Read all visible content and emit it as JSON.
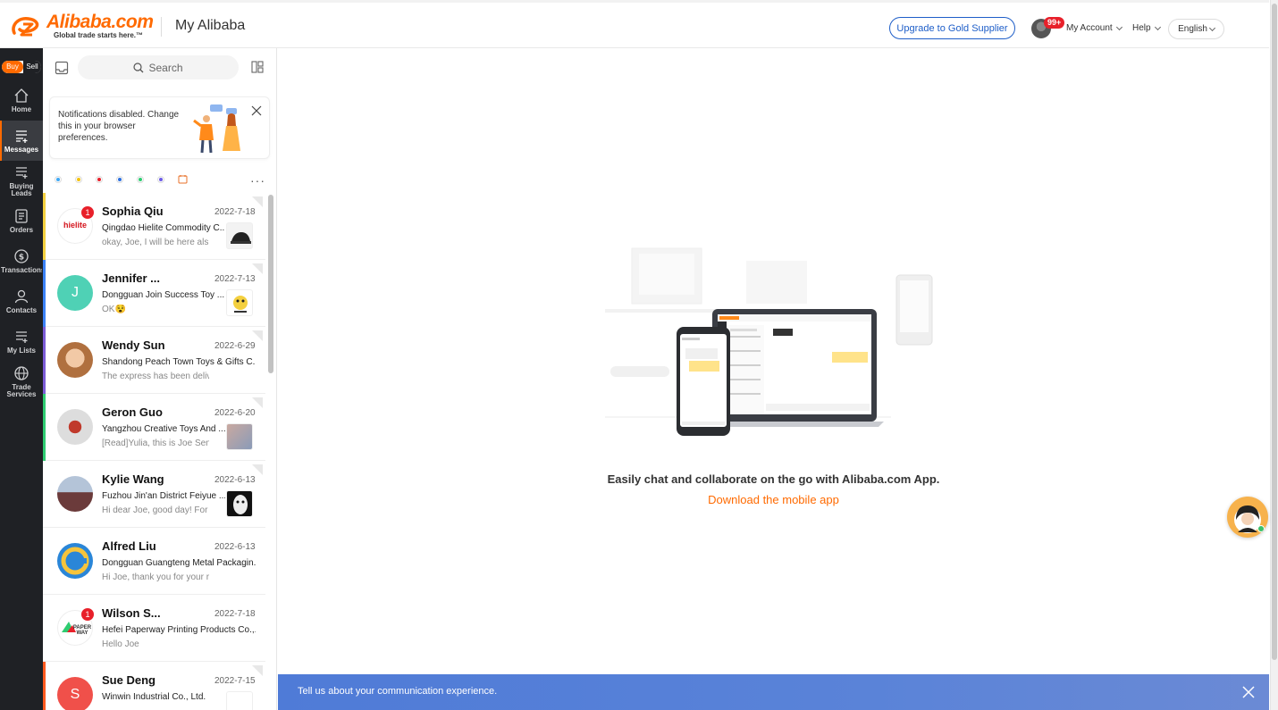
{
  "header": {
    "logo_word": "Alibaba.com",
    "logo_tagline": "Global trade starts here.™",
    "page_title": "My Alibaba",
    "gold_button": "Upgrade to Gold Supplier",
    "account_badge": "99+",
    "account_label": "My Account",
    "help_label": "Help",
    "language_label": "English",
    "brand_color": "#ff6a00"
  },
  "rail": {
    "buy": "Buy",
    "sell": "Sell",
    "items": [
      {
        "label": "Home",
        "icon": "home-icon"
      },
      {
        "label": "Messages",
        "icon": "messages-icon"
      },
      {
        "label": "Buying Leads",
        "icon": "buying-leads-icon"
      },
      {
        "label": "Orders",
        "icon": "orders-icon"
      },
      {
        "label": "Transactions",
        "icon": "dollar-icon"
      },
      {
        "label": "Contacts",
        "icon": "contacts-icon"
      },
      {
        "label": "My Lists",
        "icon": "list-icon"
      },
      {
        "label": "Trade Services",
        "icon": "globe-icon"
      }
    ]
  },
  "panel": {
    "search_placeholder": "Search",
    "notice": "Notifications disabled. Change this in your browser preferences.",
    "more": "···",
    "conversations": [
      {
        "name": "Sophia Qiu",
        "date": "2022-7-18",
        "company": "Qingdao Hielite Commodity C...",
        "preview": "okay, Joe, I will be here als",
        "badge": "1",
        "stripe": "#f4d03f"
      },
      {
        "name": "Jennifer ...",
        "date": "2022-7-13",
        "company": "Dongguan Join Success Toy ...",
        "preview": "OK😵",
        "badge": "",
        "stripe": "#3b82f6",
        "initial": "J"
      },
      {
        "name": "Wendy Sun",
        "date": "2022-6-29",
        "company": "Shandong Peach Town Toys & Gifts C...",
        "preview": "The express has been deliv...",
        "badge": "",
        "stripe": "#7c5cd6"
      },
      {
        "name": "Geron Guo",
        "date": "2022-6-20",
        "company": "Yangzhou Creative Toys And ...",
        "preview": "[Read]Yulia, this is Joe Sena...",
        "badge": "",
        "stripe": "#2ecc71"
      },
      {
        "name": "Kylie Wang",
        "date": "2022-6-13",
        "company": "Fuzhou Jin'an District Feiyue ...",
        "preview": "Hi dear Joe, good day! For",
        "badge": "",
        "stripe": ""
      },
      {
        "name": "Alfred Liu",
        "date": "2022-6-13",
        "company": "Dongguan Guangteng Metal Packagin...",
        "preview": "Hi Joe, thank you for your r...",
        "badge": "",
        "stripe": ""
      },
      {
        "name": "Wilson S...",
        "date": "2022-7-18",
        "company": "Hefei Paperway Printing Products Co.,...",
        "preview": "Hello Joe",
        "badge": "1",
        "stripe": ""
      },
      {
        "name": "Sue Deng",
        "date": "2022-7-15",
        "company": "Winwin Industrial Co., Ltd.",
        "preview": "",
        "badge": "",
        "stripe": "#ff5a1f",
        "initial": "S"
      }
    ]
  },
  "main": {
    "headline": "Easily chat and collaborate on the go with Alibaba.com App.",
    "link": "Download the mobile app",
    "feedback": "Tell us about your communication experience."
  }
}
